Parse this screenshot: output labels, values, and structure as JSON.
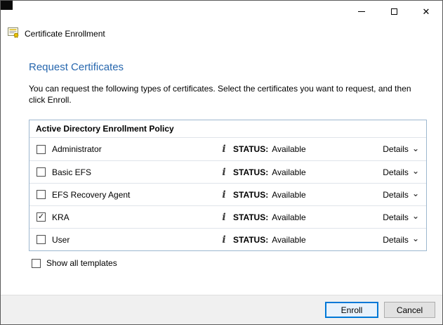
{
  "glyphs": {
    "close": "✕",
    "info": "i",
    "chevron_down": "⌄",
    "check": "✓"
  },
  "header": {
    "app_name": "Certificate Enrollment"
  },
  "content": {
    "page_title": "Request Certificates",
    "description": "You can request the following types of certificates. Select the certificates you want to request, and then click Enroll.",
    "policy_group": {
      "title": "Active Directory Enrollment Policy",
      "status_label": "STATUS:",
      "details_label": "Details",
      "templates": [
        {
          "name": "Administrator",
          "status": "Available",
          "checked": false
        },
        {
          "name": "Basic EFS",
          "status": "Available",
          "checked": false
        },
        {
          "name": "EFS Recovery Agent",
          "status": "Available",
          "checked": false
        },
        {
          "name": "KRA",
          "status": "Available",
          "checked": true
        },
        {
          "name": "User",
          "status": "Available",
          "checked": false
        }
      ]
    },
    "show_all_templates": {
      "label": "Show all templates",
      "checked": false
    }
  },
  "footer": {
    "enroll_label": "Enroll",
    "cancel_label": "Cancel"
  },
  "colors": {
    "accent": "#0078d7",
    "heading_text": "#2767ae",
    "window_border": "#5b5b5b",
    "group_border": "#9db7cf",
    "footer_bg": "#f0f0f0"
  }
}
